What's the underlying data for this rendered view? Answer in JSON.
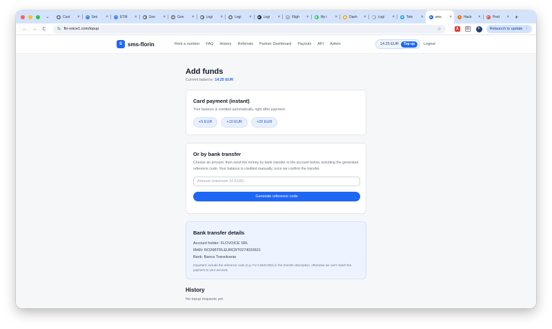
{
  "browser": {
    "tabs": [
      {
        "title": "Cust",
        "icon": "globe-icon",
        "color": "#5f6368"
      },
      {
        "title": "Smi",
        "icon": "arc-icon",
        "color": "#3b82f6"
      },
      {
        "title": "ETM",
        "icon": "arc-icon",
        "color": "#3b82f6"
      },
      {
        "title": "Goo",
        "icon": "globe-icon",
        "color": "#5f6368"
      },
      {
        "title": "Goo",
        "icon": "globe-icon",
        "color": "#5f6368"
      },
      {
        "title": "Logi",
        "icon": "globe-icon",
        "color": "#5f6368"
      },
      {
        "title": "Logi",
        "icon": "globe-icon",
        "color": "#5f6368"
      },
      {
        "title": "Logi",
        "icon": "square-icon",
        "color": "#1f2937"
      },
      {
        "title": "Fligh",
        "icon": "plane-icon",
        "color": "#9ca3af"
      },
      {
        "title": "My i",
        "icon": "phone-icon",
        "color": "#22c55e"
      },
      {
        "title": "Dash",
        "icon": "bulb-icon",
        "color": "#f59e0b"
      },
      {
        "title": "Logi",
        "icon": "doc-icon",
        "color": "#9ca3af"
      },
      {
        "title": "Tele",
        "icon": "telegram-icon",
        "color": "#2aa3e0"
      },
      {
        "title": "sms",
        "icon": "sms-icon",
        "color": "#1e66f5",
        "active": true
      },
      {
        "title": "Hack",
        "icon": "y-icon",
        "color": "#ff6600"
      },
      {
        "title": "Prod",
        "icon": "p-icon",
        "color": "#da552f"
      }
    ],
    "new_tab_label": "+",
    "url": "flo-voice1.com/topup",
    "profile_initial": "F",
    "relaunch_label": "Relaunch to update"
  },
  "site": {
    "brand_letter": "S",
    "brand_name": "sms-florin",
    "nav": [
      "Rent a number",
      "FAQ",
      "History",
      "Referrals",
      "Partner Dashboard",
      "Payouts",
      "API",
      "Admin"
    ],
    "balance": "14.25 EUR",
    "topup_label": "Top up",
    "logout_label": "Logout"
  },
  "main": {
    "title": "Add funds",
    "balance_label": "Current balance:",
    "balance_value": "14.25 EUR",
    "card_payment": {
      "title": "Card payment (instant)",
      "text": "Your balance is credited automatically, right after payment.",
      "amounts": [
        "+5 EUR",
        "+10 EUR",
        "+20 EUR"
      ]
    },
    "bank_transfer": {
      "title": "Or by bank transfer",
      "text": "Choose an amount, then send the money by bank transfer to the account below, including the generated reference code. Your balance is credited manually, once we confirm the transfer.",
      "input_placeholder": "Amount (minimum 10 EUR)",
      "button_label": "Generate reference code"
    },
    "bank_details": {
      "title": "Bank transfer details",
      "account_holder": "Account holder: FLOVOICE SRL",
      "iban": "IBAN: RO26BTRLEURCRT0274032601",
      "bank": "Bank: Banca Transilvania",
      "note": "Important: include the reference code (e.g. FV-A1B2C3D4) in the transfer description, otherwise we can't match the payment to your account."
    },
    "history": {
      "title": "History",
      "empty_text": "No topup requests yet."
    }
  }
}
